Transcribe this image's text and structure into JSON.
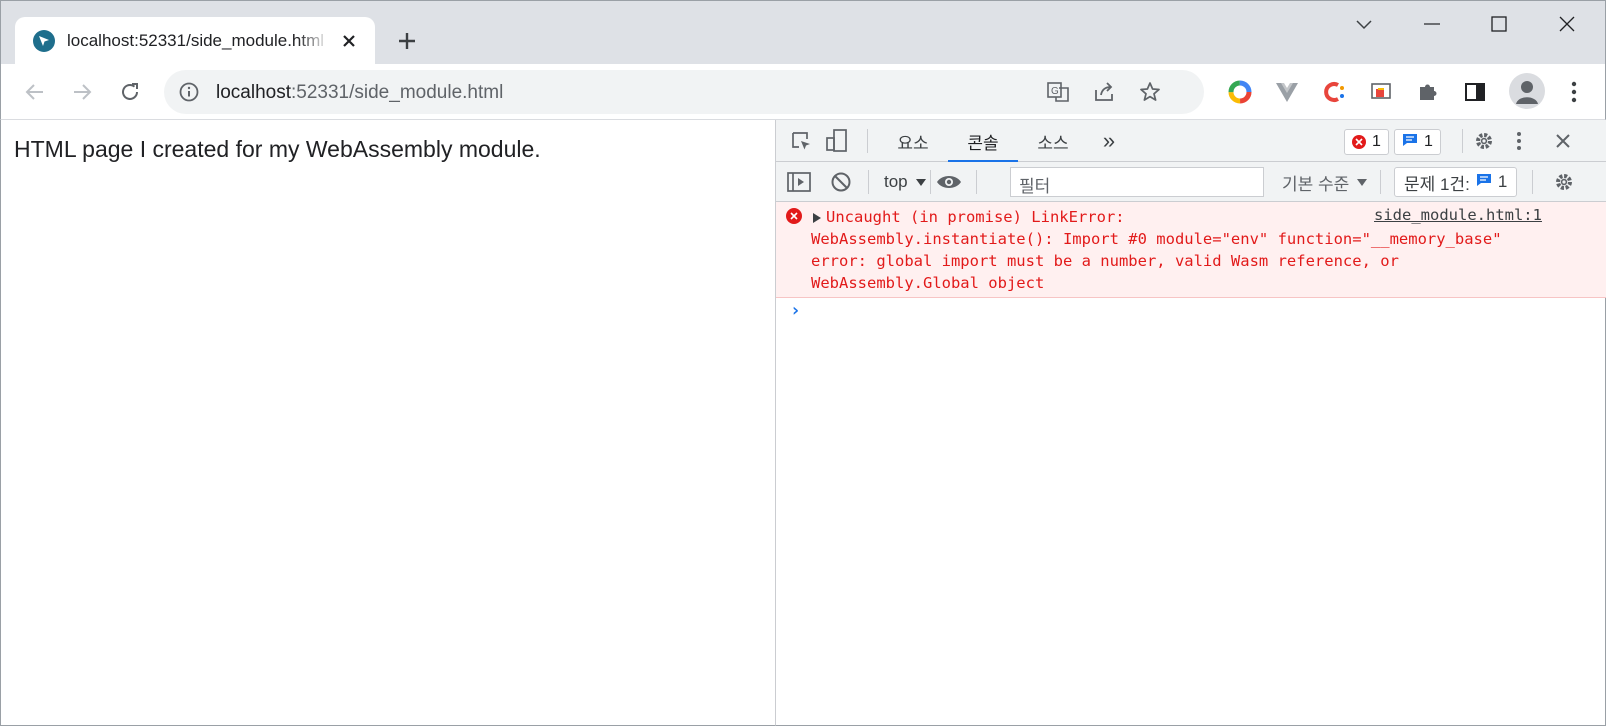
{
  "browser": {
    "tab": {
      "title": "localhost:52331/side_module.html",
      "favicon": "cursor-favicon",
      "close_icon": "close-icon"
    },
    "new_tab_icon": "plus-icon",
    "window_controls": [
      "chevron-down-icon",
      "minimize-icon",
      "maximize-icon",
      "close-icon"
    ],
    "nav": [
      "back-icon",
      "forward-icon",
      "reload-icon"
    ],
    "address": {
      "host": "localhost",
      "rest": ":52331/side_module.html"
    },
    "omnibox_icons": [
      "translate-icon",
      "share-icon",
      "star-icon"
    ],
    "extensions": [
      "color-wheel-icon",
      "vue-icon",
      "c-extension-icon",
      "cast-icon",
      "puzzle-icon",
      "side-panel-icon",
      "avatar-icon",
      "kebab-menu-icon"
    ]
  },
  "page": {
    "text": "HTML page I created for my WebAssembly module."
  },
  "devtools": {
    "tabs": [
      {
        "label": "요소",
        "active": false
      },
      {
        "label": "콘솔",
        "active": true
      },
      {
        "label": "소스",
        "active": false
      }
    ],
    "more_tabs_label": "»",
    "error_badge_count": "1",
    "message_badge_count": "1",
    "toolbar": {
      "context": "top",
      "filter_placeholder": "필터",
      "levels": "기본 수준",
      "issues_label": "문제 1건:",
      "issues_count": "1"
    },
    "console": {
      "error_lines": [
        "Uncaught (in promise) LinkError:",
        "WebAssembly.instantiate(): Import #0 module=\"env\" function=\"__memory_base\"",
        "error: global import must be a number, valid Wasm reference, or",
        "WebAssembly.Global object"
      ],
      "source": "side_module.html:1",
      "prompt": "›"
    },
    "colors": {
      "accent": "#1a73e8",
      "error": "#e21a1a",
      "error_bg": "#fff0f0"
    }
  }
}
